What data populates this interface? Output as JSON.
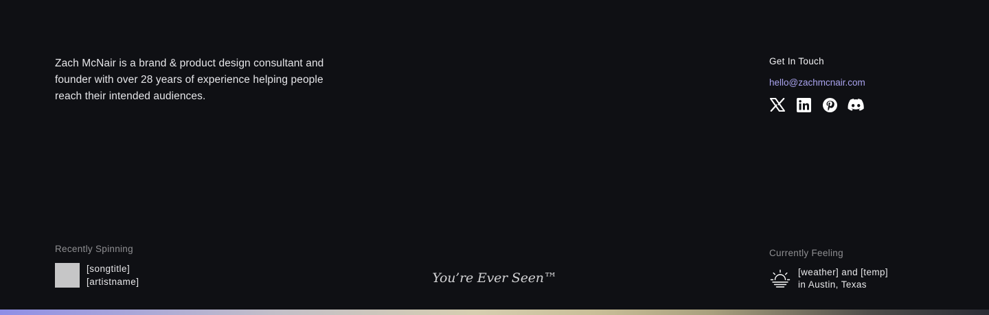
{
  "bio": {
    "line1": "Zach McNair is a brand & product design consultant and",
    "line2": "founder with over 28 years of experience helping people",
    "line3": "reach their intended audiences."
  },
  "contact": {
    "heading": "Get In Touch",
    "email": "hello@zachmcnair.com",
    "socials": [
      {
        "icon": "x-icon",
        "label": "X"
      },
      {
        "icon": "linkedin-icon",
        "label": "LinkedIn"
      },
      {
        "icon": "pinterest-icon",
        "label": "Pinterest"
      },
      {
        "icon": "discord-icon",
        "label": "Discord"
      }
    ]
  },
  "spinning": {
    "label": "Recently Spinning",
    "song": "[songtitle]",
    "artist": "[artistname]"
  },
  "tagline": "You’re Ever Seen™",
  "feeling": {
    "label": "Currently Feeling",
    "line1": "[weather] and [temp]",
    "line2": "in Austin, Texas",
    "icon": "sunrise-icon"
  },
  "colors": {
    "background": "#0f1014",
    "accent": "#a9a3ee",
    "muted": "#8f8f92"
  }
}
